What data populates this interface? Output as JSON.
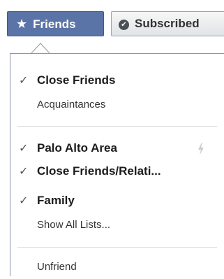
{
  "toolbar": {
    "friends_label": "Friends",
    "friends_icon": "star-icon",
    "subscribed_label": "Subscribed",
    "subscribed_icon": "check-circle-icon",
    "friends_color": "#5b74a8"
  },
  "menu": {
    "groups": [
      {
        "items": [
          {
            "label": "Close Friends",
            "checked": true,
            "bold": true
          },
          {
            "label": "Acquaintances",
            "checked": false,
            "bold": false
          }
        ]
      },
      {
        "items": [
          {
            "label": "Palo Alto Area",
            "checked": true,
            "bold": true,
            "icon": "lightning-bolt-icon"
          },
          {
            "label": "Close Friends/Relati...",
            "checked": true,
            "bold": true
          },
          {
            "label": "Family",
            "checked": true,
            "bold": true
          },
          {
            "label": "Show All Lists...",
            "checked": false,
            "bold": false
          }
        ]
      },
      {
        "items": [
          {
            "label": "Unfriend",
            "checked": false,
            "bold": false
          }
        ]
      }
    ],
    "check_glyph": "✓"
  }
}
